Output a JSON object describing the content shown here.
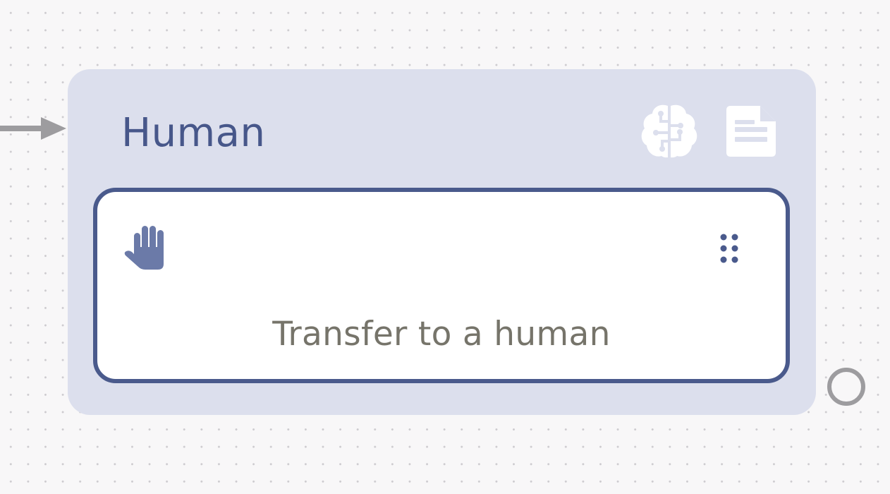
{
  "node": {
    "title": "Human",
    "actions": {
      "brain_icon": "brain-icon",
      "document_icon": "document-icon"
    },
    "step": {
      "icon": "hand-icon",
      "handle_icon": "drag-handle-icon",
      "label": "Transfer to a human"
    }
  },
  "colors": {
    "canvas_bg": "#f8f7f8",
    "node_bg": "#dcdfed",
    "accent": "#4a5a8c",
    "title_text": "#47578a",
    "step_text": "#76746a",
    "connector": "#9d9c9f",
    "hand_fill": "#6b7aa8"
  }
}
